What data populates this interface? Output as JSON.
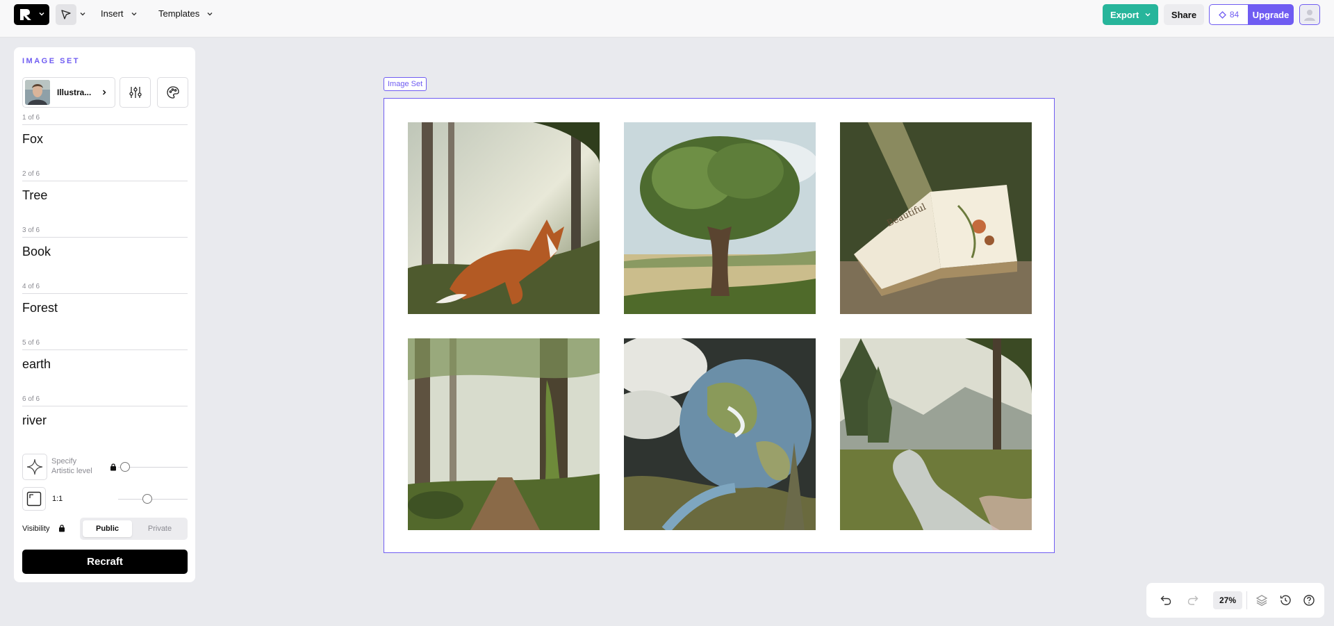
{
  "toolbar": {
    "insert_label": "Insert",
    "templates_label": "Templates",
    "export_label": "Export",
    "share_label": "Share",
    "credits_count": "84",
    "upgrade_label": "Upgrade"
  },
  "panel": {
    "title": "IMAGE SET",
    "style_name": "Illustra...",
    "prompts": [
      {
        "counter": "1 of 6",
        "text": "Fox"
      },
      {
        "counter": "2 of 6",
        "text": "Tree"
      },
      {
        "counter": "3 of 6",
        "text": "Book"
      },
      {
        "counter": "4 of 6",
        "text": "Forest"
      },
      {
        "counter": "5 of 6",
        "text": "earth"
      },
      {
        "counter": "6 of 6",
        "text": "river"
      }
    ],
    "artistic_label_line1": "Specify",
    "artistic_label_line2": "Artistic level",
    "artistic_level": 0,
    "aspect_ratio_label": "1:1",
    "aspect_ratio_slider": 0.5,
    "visibility_label": "Visibility",
    "visibility_options": [
      "Public",
      "Private"
    ],
    "visibility_selected": "Public",
    "recraft_label": "Recraft"
  },
  "canvas": {
    "frame_label": "Image Set",
    "images": [
      {
        "subject": "fox"
      },
      {
        "subject": "tree"
      },
      {
        "subject": "book"
      },
      {
        "subject": "forest"
      },
      {
        "subject": "earth"
      },
      {
        "subject": "river"
      }
    ]
  },
  "bottom_toolbar": {
    "zoom": "27%",
    "icons": [
      "undo-icon",
      "redo-icon",
      "layers-icon",
      "history-icon",
      "help-icon"
    ]
  },
  "colors": {
    "accent": "#6f5cf2",
    "export": "#27b59b",
    "canvas_bg": "#e9eaee"
  }
}
